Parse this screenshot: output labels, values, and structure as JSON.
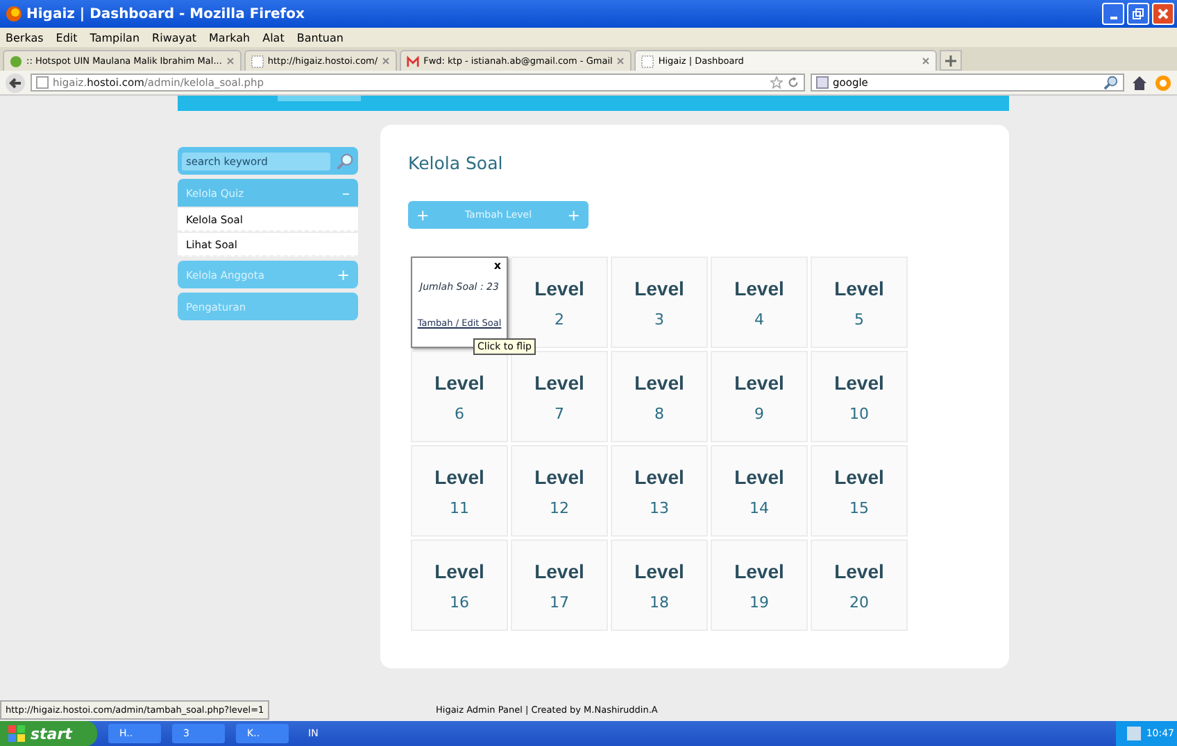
{
  "window": {
    "title": "Higaiz | Dashboard - Mozilla Firefox"
  },
  "menu": [
    "Berkas",
    "Edit",
    "Tampilan",
    "Riwayat",
    "Markah",
    "Alat",
    "Bantuan"
  ],
  "tabs": [
    {
      "label": ":: Hotspot UIN Maulana Malik Ibrahim Mal...",
      "selected": false,
      "kind": "hotspot"
    },
    {
      "label": "http://higaiz.hostoi.com/",
      "selected": false,
      "kind": "blank"
    },
    {
      "label": "Fwd: ktp - istianah.ab@gmail.com - Gmail",
      "selected": false,
      "kind": "gmail"
    },
    {
      "label": "Higaiz | Dashboard",
      "selected": true,
      "kind": "blank"
    }
  ],
  "address": {
    "host": "higaiz.",
    "domain": "hostoi.com",
    "path": "/admin/kelola_soal.php"
  },
  "search": {
    "value": "google"
  },
  "sidebar": {
    "search_placeholder": "search keyword",
    "sections": [
      {
        "label": "Kelola Quiz",
        "expanded": true,
        "toggle": "–",
        "items": [
          "Kelola Soal",
          "Lihat Soal"
        ]
      },
      {
        "label": "Kelola Anggota",
        "expanded": false,
        "toggle": "+"
      },
      {
        "label": "Pengaturan"
      }
    ]
  },
  "main": {
    "title": "Kelola Soal",
    "add_button": {
      "label": "Tambah Level",
      "icon_left": "+",
      "icon_right": "+"
    },
    "levels": [
      {
        "flipped": true,
        "close": "x",
        "count": "Jumlah Soal : 23",
        "link": "Tambah / Edit Soal",
        "tooltip": "Click to flip"
      },
      {
        "label": "Level",
        "number": "2",
        "flipped": false
      },
      {
        "label": "Level",
        "number": "3",
        "flipped": false
      },
      {
        "label": "Level",
        "number": "4",
        "flipped": false
      },
      {
        "label": "Level",
        "number": "5",
        "flipped": false
      },
      {
        "label": "Level",
        "number": "6",
        "flipped": false
      },
      {
        "label": "Level",
        "number": "7",
        "flipped": false
      },
      {
        "label": "Level",
        "number": "8",
        "flipped": false
      },
      {
        "label": "Level",
        "number": "9",
        "flipped": false
      },
      {
        "label": "Level",
        "number": "10",
        "flipped": false
      },
      {
        "label": "Level",
        "number": "11",
        "flipped": false
      },
      {
        "label": "Level",
        "number": "12",
        "flipped": false
      },
      {
        "label": "Level",
        "number": "13",
        "flipped": false
      },
      {
        "label": "Level",
        "number": "14",
        "flipped": false
      },
      {
        "label": "Level",
        "number": "15",
        "flipped": false
      },
      {
        "label": "Level",
        "number": "16",
        "flipped": false
      },
      {
        "label": "Level",
        "number": "17",
        "flipped": false
      },
      {
        "label": "Level",
        "number": "18",
        "flipped": false
      },
      {
        "label": "Level",
        "number": "19",
        "flipped": false
      },
      {
        "label": "Level",
        "number": "20",
        "flipped": false
      }
    ]
  },
  "footer": "Higaiz Admin Panel | Created by M.Nashiruddin.A",
  "status_url": "http://higaiz.hostoi.com/admin/tambah_soal.php?level=1",
  "taskbar": {
    "start": "start",
    "items": [
      "H..",
      "3",
      "K.."
    ],
    "lang": "IN",
    "clock": "10:47"
  }
}
